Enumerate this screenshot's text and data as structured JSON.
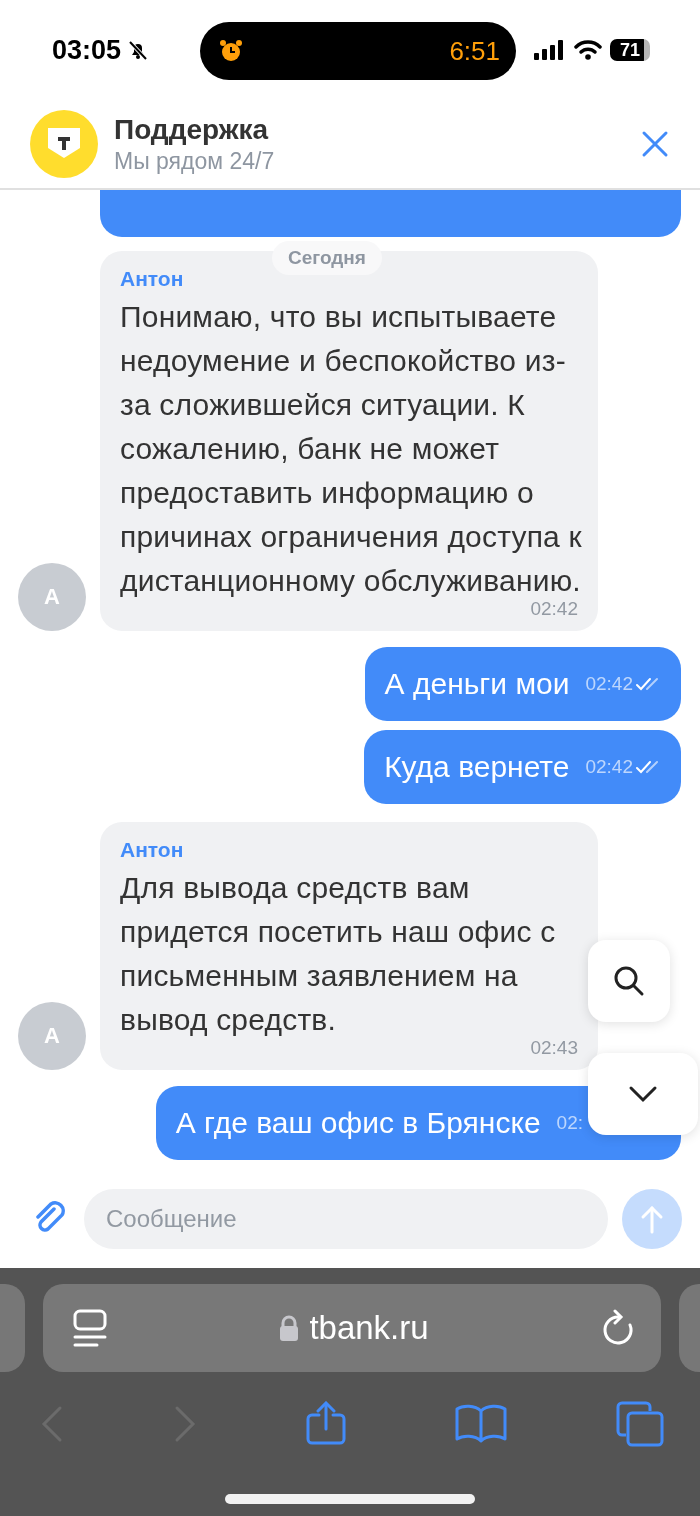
{
  "status_bar": {
    "time": "03:05",
    "silent": true,
    "island_time": "6:51",
    "battery": "71"
  },
  "header": {
    "title": "Поддержка",
    "subtitle": "Мы рядом 24/7"
  },
  "date_chip": "Сегодня",
  "messages": [
    {
      "kind": "cut"
    },
    {
      "kind": "incoming",
      "author": "Антон",
      "avatar": "А",
      "text": "Понимаю, что вы испытываете недоумение и беспокойство из-за сложившейся ситуации. К сожалению, банк не может предоставить информацию о причинах ограничения доступа к дистанционному обслуживанию.",
      "time": "02:42"
    },
    {
      "kind": "outgoing",
      "text": "А деньги мои",
      "time": "02:42",
      "read": true
    },
    {
      "kind": "outgoing",
      "text": "Куда вернете",
      "time": "02:42",
      "read": true
    },
    {
      "kind": "incoming",
      "author": "Антон",
      "avatar": "А",
      "text": "Для вывода средств вам придется посетить наш офис с письменным заявлением на вывод средств.",
      "time": "02:43"
    },
    {
      "kind": "outgoing",
      "text": "А где ваш офис в Брянске",
      "time": "02:",
      "read": false
    }
  ],
  "composer": {
    "placeholder": "Сообщение"
  },
  "browser": {
    "url": "tbank.ru"
  }
}
